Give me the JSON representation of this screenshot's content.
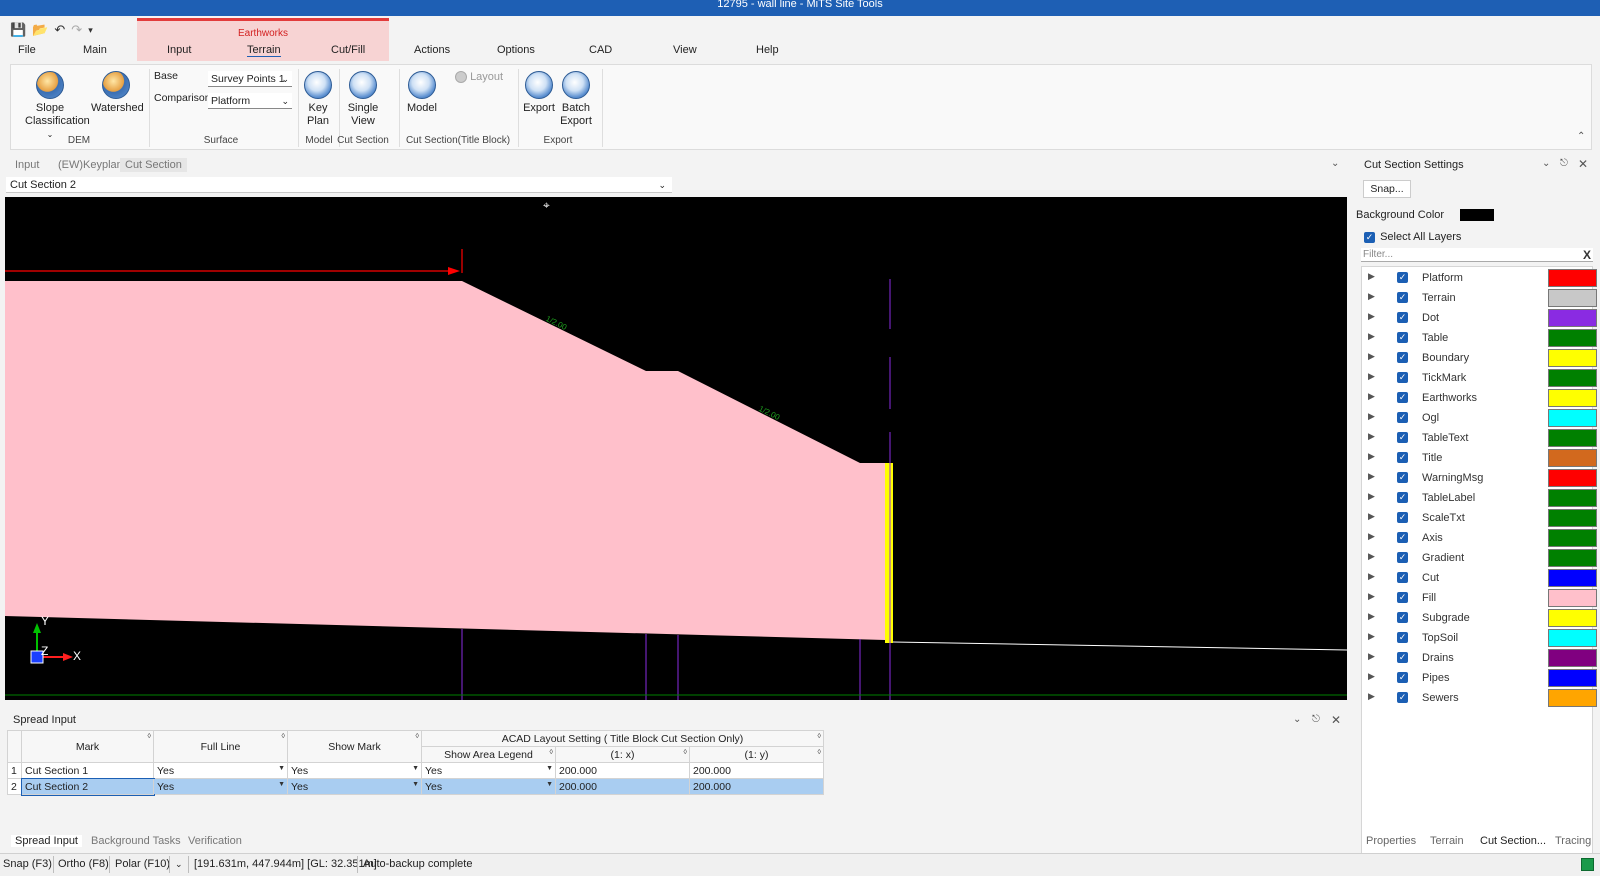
{
  "window": {
    "title": "12795 - wall line - MiTS Site Tools"
  },
  "qat": {
    "icons": [
      "save-icon",
      "open-icon",
      "undo-icon",
      "redo-icon",
      "dropdown-icon"
    ]
  },
  "menu": {
    "file": "File",
    "main": "Main",
    "input": "Input",
    "terrain": "Terrain",
    "cutfill": "Cut/Fill",
    "actions": "Actions",
    "options": "Options",
    "cad": "CAD",
    "view": "View",
    "help": "Help",
    "context_group": "Earthworks"
  },
  "ribbon": {
    "slope_label": "Slope",
    "classification_label": "Classification",
    "watershed_label": "Watershed",
    "dem_group": "DEM",
    "base_label": "Base",
    "base_value": "Survey Points 1",
    "comparison_label": "Comparison",
    "comparison_value": "Platform",
    "surface_group": "Surface",
    "key_label": "Key",
    "plan_label": "Plan",
    "model_group": "Model",
    "single_label": "Single",
    "view_label": "View",
    "cut_section_group": "Cut Section",
    "model_label": "Model",
    "layout_label": "Layout",
    "cut_section_tb_group": "Cut Section(Title Block)",
    "export_label": "Export",
    "batch_label": "Batch",
    "batch_export_label": "Export",
    "export_group": "Export"
  },
  "doc_tabs": {
    "input": "Input",
    "keyplan": "(EW)Keyplan",
    "cut_section": "Cut Section"
  },
  "section_select": {
    "value": "Cut Section 2"
  },
  "canvas": {
    "slope_label_1": "1/2.00",
    "slope_label_2": "1/2.00",
    "axis_y": "Y",
    "axis_z": "Z",
    "axis_x": "X",
    "colors": {
      "fill": "#ffc0cb",
      "background": "#000000",
      "cut_marker": "#ff0000",
      "purple": "#8a2be2",
      "yellow": "#ffff00",
      "ground": "#ffffff",
      "green_line": "#008000"
    }
  },
  "settings_panel": {
    "title": "Cut Section Settings",
    "snap_button": "Snap...",
    "background_color_label": "Background Color",
    "select_all_layers": "Select All Layers",
    "filter_placeholder": "Filter...",
    "filter_clear": "X",
    "layers": [
      {
        "name": "Platform",
        "color": "#ff0000"
      },
      {
        "name": "Terrain",
        "color": "#c8c8c8"
      },
      {
        "name": "Dot",
        "color": "#8a2be2"
      },
      {
        "name": "Table",
        "color": "#008000"
      },
      {
        "name": "Boundary",
        "color": "#ffff00"
      },
      {
        "name": "TickMark",
        "color": "#008000"
      },
      {
        "name": "Earthworks",
        "color": "#ffff00"
      },
      {
        "name": "Ogl",
        "color": "#00ffff"
      },
      {
        "name": "TableText",
        "color": "#008000"
      },
      {
        "name": "Title",
        "color": "#d2691e"
      },
      {
        "name": "WarningMsg",
        "color": "#ff0000"
      },
      {
        "name": "TableLabel",
        "color": "#008000"
      },
      {
        "name": "ScaleTxt",
        "color": "#008000"
      },
      {
        "name": "Axis",
        "color": "#008000"
      },
      {
        "name": "Gradient",
        "color": "#008000"
      },
      {
        "name": "Cut",
        "color": "#0000ff"
      },
      {
        "name": "Fill",
        "color": "#ffc0cb"
      },
      {
        "name": "Subgrade",
        "color": "#ffff00"
      },
      {
        "name": "TopSoil",
        "color": "#00ffff"
      },
      {
        "name": "Drains",
        "color": "#800080"
      },
      {
        "name": "Pipes",
        "color": "#0000ff"
      },
      {
        "name": "Sewers",
        "color": "#ffa500"
      }
    ],
    "bottom_tabs": {
      "properties": "Properties",
      "terrain": "Terrain",
      "cut_section": "Cut Section...",
      "tracing": "Tracing"
    }
  },
  "spread": {
    "title": "Spread Input",
    "headers": {
      "mark": "Mark",
      "full_line": "Full Line",
      "show_mark": "Show Mark",
      "acad": "ACAD Layout Setting ( Title Block Cut Section Only)",
      "show_area_legend": "Show Area Legend",
      "x": "(1: x)",
      "y": "(1: y)"
    },
    "rows": [
      {
        "num": "1",
        "mark": "Cut Section 1",
        "full_line": "Yes",
        "show_mark": "Yes",
        "legend": "Yes",
        "x": "200.000",
        "y": "200.000"
      },
      {
        "num": "2",
        "mark": "Cut Section 2",
        "full_line": "Yes",
        "show_mark": "Yes",
        "legend": "Yes",
        "x": "200.000",
        "y": "200.000"
      }
    ]
  },
  "bottom_tabs": {
    "spread": "Spread Input",
    "bg_tasks": "Background Tasks",
    "verification": "Verification"
  },
  "status": {
    "snap": "Snap (F3)",
    "ortho": "Ortho (F8)",
    "polar": "Polar (F10)",
    "coords": "[191.631m, 447.944m] [GL: 32.351m]",
    "message": "Auto-backup complete"
  }
}
